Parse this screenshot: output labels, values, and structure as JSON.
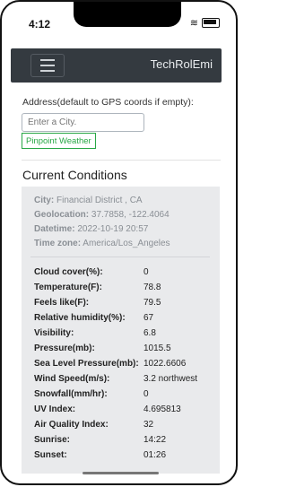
{
  "status": {
    "time": "4:12"
  },
  "navbar": {
    "brand": "TechRolEmi"
  },
  "address": {
    "label": "Address(default to GPS coords if empty):",
    "placeholder": "Enter a City.",
    "button_label": "Pinpoint Weather"
  },
  "current": {
    "title": "Current Conditions",
    "city_label": "City:",
    "city_value": "Financial District , CA",
    "geo_label": "Geolocation:",
    "geo_value": "37.7858, -122.4064",
    "dt_label": "Datetime:",
    "dt_value": "2022-10-19 20:57",
    "tz_label": "Time zone:",
    "tz_value": "America/Los_Angeles"
  },
  "metrics": [
    {
      "label": "Cloud cover(%):",
      "value": "0"
    },
    {
      "label": "Temperature(F):",
      "value": "78.8"
    },
    {
      "label": "Feels like(F):",
      "value": "79.5"
    },
    {
      "label": "Relative humidity(%):",
      "value": "67"
    },
    {
      "label": "Visibility:",
      "value": "6.8"
    },
    {
      "label": "Pressure(mb):",
      "value": "1015.5"
    },
    {
      "label": "Sea Level Pressure(mb):",
      "value": "1022.6606"
    },
    {
      "label": "Wind Speed(m/s):",
      "value": "3.2 northwest"
    },
    {
      "label": "Snowfall(mm/hr):",
      "value": "0"
    },
    {
      "label": "UV Index:",
      "value": "4.695813"
    },
    {
      "label": "Air Quality Index:",
      "value": "32"
    },
    {
      "label": "Sunrise:",
      "value": "14:22"
    },
    {
      "label": "Sunset:",
      "value": "01:26"
    }
  ]
}
